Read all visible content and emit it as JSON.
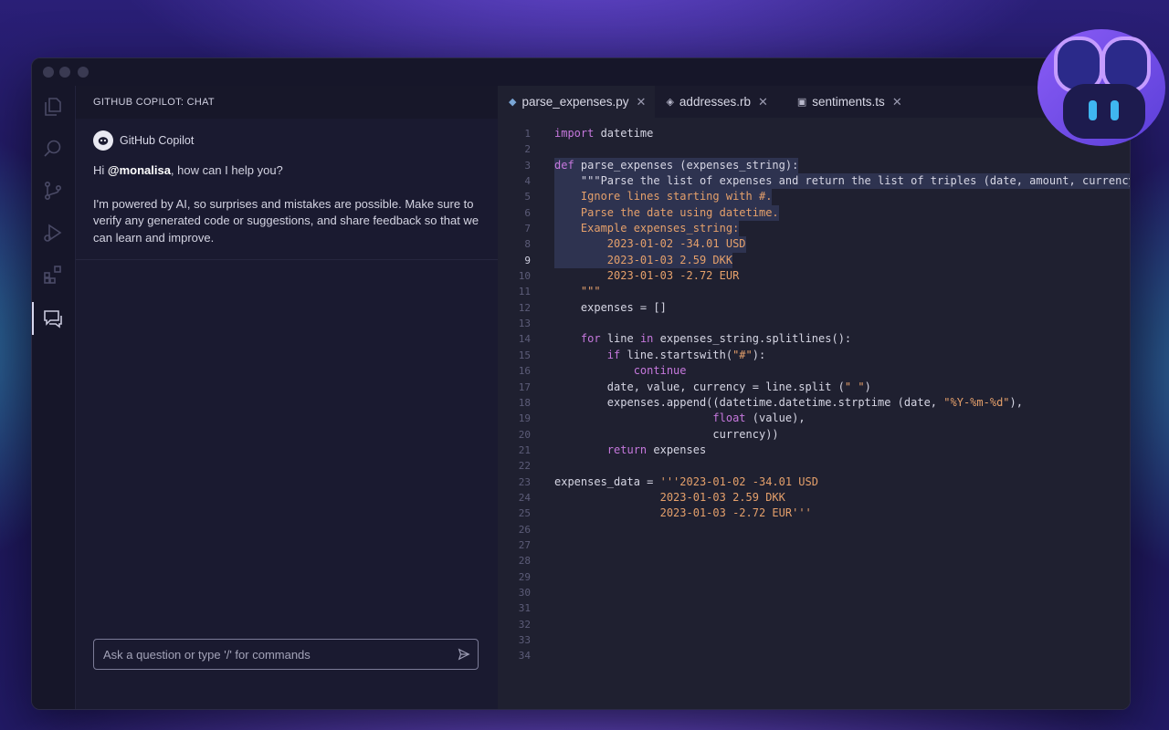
{
  "chat": {
    "header_title": "GITHUB COPILOT: CHAT",
    "assistant_name": "GitHub Copilot",
    "greeting_prefix": "Hi ",
    "greeting_user": "@monalisa",
    "greeting_suffix": ", how can I help you?",
    "disclaimer": "I'm powered by AI, so surprises and mistakes are possible. Make sure to verify any generated code or suggestions, and share feedback so that we can learn and improve.",
    "input_placeholder": "Ask a question or type '/' for commands"
  },
  "tabs": [
    {
      "label": "parse_expenses.py",
      "icon": "python-file-icon",
      "active": true
    },
    {
      "label": "addresses.rb",
      "icon": "ruby-file-icon",
      "active": false
    },
    {
      "label": "sentiments.ts",
      "icon": "typescript-file-icon",
      "active": false
    }
  ],
  "editor": {
    "current_line": 9,
    "total_lines": 34,
    "code": [
      "import datetime",
      "",
      "def parse_expenses (expenses_string):",
      "    \"\"\"Parse the list of expenses and return the list of triples (date, amount, currency",
      "    Ignore lines starting with #.",
      "    Parse the date using datetime.",
      "    Example expenses_string:",
      "        2023-01-02 -34.01 USD",
      "        2023-01-03 2.59 DKK",
      "        2023-01-03 -2.72 EUR",
      "    \"\"\"",
      "    expenses = []",
      "",
      "    for line in expenses_string.splitlines():",
      "        if line.startswith(\"#\"):",
      "            continue",
      "        date, value, currency = line.split (\" \")",
      "        expenses.append((datetime.datetime.strptime (date, \"%Y-%m-%d\"),",
      "                        float (value),",
      "                        currency))",
      "        return expenses",
      "",
      "expenses_data = '''2023-01-02 -34.01 USD",
      "                2023-01-03 2.59 DKK",
      "                2023-01-03 -2.72 EUR'''",
      "",
      "",
      "",
      "",
      "",
      "",
      "",
      "",
      ""
    ]
  },
  "colors": {
    "keyword": "#c678dd",
    "param": "#61afef",
    "string": "#e5a06b",
    "selection": "#2e3350"
  }
}
